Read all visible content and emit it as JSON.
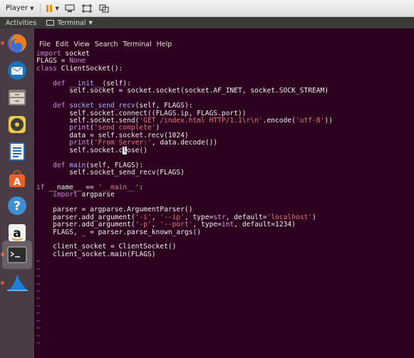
{
  "player": {
    "menu_label": "Player",
    "colors": {
      "pause": "#f08a00"
    }
  },
  "panel": {
    "activities": "Activities",
    "app_menu": "Terminal"
  },
  "launcher": {
    "items": [
      {
        "name": "firefox-icon"
      },
      {
        "name": "thunderbird-icon"
      },
      {
        "name": "files-icon"
      },
      {
        "name": "rhythmbox-icon"
      },
      {
        "name": "libreoffice-writer-icon"
      },
      {
        "name": "software-center-icon"
      },
      {
        "name": "help-icon"
      },
      {
        "name": "amazon-icon"
      },
      {
        "name": "terminal-icon"
      },
      {
        "name": "wireshark-icon"
      }
    ]
  },
  "terminal": {
    "menu": [
      "File",
      "Edit",
      "View",
      "Search",
      "Terminal",
      "Help"
    ],
    "lines": [
      "import socket",
      "FLAGS = None",
      "class ClientSocket():",
      "",
      "    def __init__(self):",
      "        self.socket = socket.socket(socket.AF_INET, socket.SOCK_STREAM)",
      "",
      "    def socket_send_recv(self, FLAGS):",
      "        self.socket.connect((FLAGS.ip, FLAGS.port))",
      "        self.socket.send('GET /index.html HTTP/1.1\\r\\n'.encode('utf-8'))",
      "        print('send complete')",
      "        data = self.socket.recv(1024)",
      "        print('From Server:', data.decode())",
      "        self.socket.close()",
      "",
      "    def main(self, FLAGS):",
      "        self.socket_send_recv(FLAGS)",
      "",
      "if __name__ == '__main__':",
      "    import argparse",
      "",
      "    parser = argparse.ArgumentParser()",
      "    parser.add_argument('-i', '--ip', type=str, default='localhost')",
      "    parser.add_argument('-p', '--port', type=int, default=1234)",
      "    FLAGS, _ = parser.parse_known_args()",
      "",
      "    client_socket = ClientSocket()",
      "    client_socket.main(FLAGS)",
      "~",
      "~",
      "~",
      "~",
      "~",
      "~",
      "~",
      "~",
      "~",
      "~",
      "~",
      "~"
    ],
    "colors": {
      "background": "#2c001e",
      "keyword": "#cc8bd9",
      "function": "#9fb7ff",
      "string": "#e37979",
      "tilde": "#5f7fe0"
    }
  }
}
